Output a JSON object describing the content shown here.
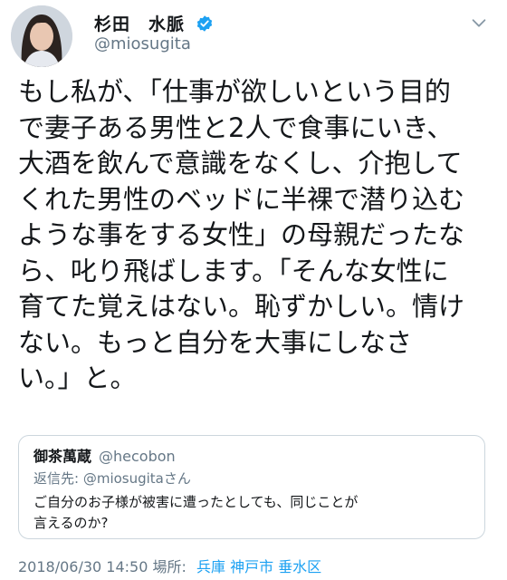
{
  "user": {
    "display_name": "杉田　水脈",
    "handle": "@miosugita"
  },
  "tweet": {
    "text": "もし私が、「仕事が欲しいという目的\nで妻子ある男性と2人で食事にいき、\n大酒を飲んで意識をなくし、介抱して\nくれた男性のベッドに半裸で潜り込む\nような事をする女性」の母親だったな\nら、叱り飛ばします。「そんな女性に\n育てた覚えはない。恥ずかしい。情け\nない。もっと自分を大事にしなさ\nい。」と。"
  },
  "quoted": {
    "name": "御茶萬蔵",
    "handle": "@hecobon",
    "reply_prefix": "返信先: ",
    "reply_handle": "@miosugita",
    "reply_suffix": "さん",
    "text": "ご自分のお子様が被害に遭ったとしても、同じことが\n言えるのか?"
  },
  "footer": {
    "timestamp": "2018/06/30 14:50",
    "location_label": "場所: ",
    "location": "兵庫 神戸市 垂水区"
  },
  "icons": {
    "verified": "verified-badge-icon",
    "menu": "chevron-down-icon"
  },
  "colors": {
    "accent": "#1da1f2",
    "text": "#14171a",
    "muted": "#657786"
  }
}
